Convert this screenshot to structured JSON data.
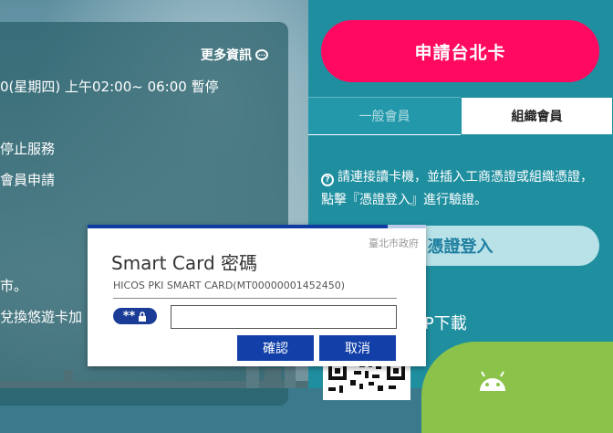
{
  "notice": {
    "more_info": "更多資訊",
    "lines": [
      "0(星期四) 上午02:00~ 06:00 暫停",
      "停止服務",
      "會員申請",
      "市。",
      "兌換悠遊卡加"
    ]
  },
  "right": {
    "apply_button": "申請台北卡",
    "tabs": [
      "一般會員",
      "組織會員"
    ],
    "instruction": "請連接讀卡機，並插入工商憑證或組織憑證，點擊『憑證登入』進行驗證。",
    "cert_login": "憑證登入",
    "app_download": "PP下載"
  },
  "dialog": {
    "org": "臺北市政府",
    "title": "Smart Card 密碼",
    "card_info": "HICOS PKI SMART CARD(MT00000001452450)",
    "pin_badge": "**",
    "pin_value": "",
    "confirm": "確認",
    "cancel": "取消"
  },
  "colors": {
    "accent_pink": "#ff0a60",
    "teal": "#1f8fa0",
    "dialog_blue": "#1240a8",
    "android_green": "#8bc34a"
  },
  "icons": [
    "info-bubble-icon",
    "help-icon",
    "lock-icon",
    "android-icon",
    "qr-code-icon"
  ]
}
